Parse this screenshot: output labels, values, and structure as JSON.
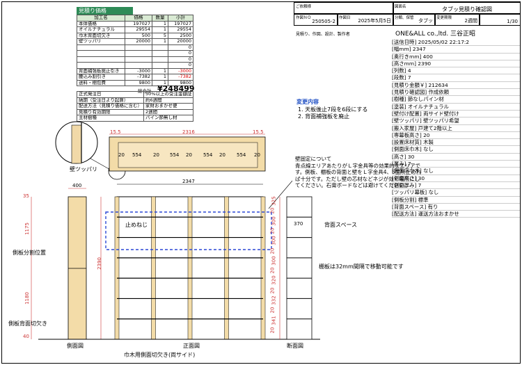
{
  "estimate": {
    "title": "見積り価格",
    "headers": [
      "加工名",
      "価格",
      "数量",
      "小計"
    ],
    "rows": [
      [
        "本体価格",
        "197027",
        "1",
        "197027"
      ],
      [
        "オイルナチュラル",
        "29554",
        "1",
        "29554"
      ],
      [
        "巾木背面切欠き",
        "500",
        "5",
        "2500"
      ],
      [
        "壁ツッパリ",
        "20000",
        "1",
        "20000"
      ],
      [
        "",
        "",
        "",
        "0"
      ],
      [
        "",
        "",
        "",
        "0"
      ],
      [
        "",
        "",
        "",
        "0"
      ],
      [
        "",
        "",
        "",
        "0"
      ],
      [
        "背面補強板廃止引き",
        "-3000",
        "1",
        "-3000"
      ],
      [
        "腰込み割引き",
        "-7382",
        "1",
        "-7382"
      ],
      [
        "送料・梱包費",
        "9800",
        "1",
        "9800"
      ]
    ],
    "total_label": "総合計",
    "total_value": "¥248499",
    "terms": [
      [
        "正式発注日",
        "50%以上の受注金額証"
      ],
      [
        "納期（受注日より起算）",
        "約6週間"
      ],
      [
        "配送方法（見積り価格に含む）",
        "家財おまかせ便"
      ],
      [
        "見積り有効期限",
        "2週間"
      ],
      [
        "主材樹種",
        "パイン節無し材"
      ]
    ]
  },
  "title_block": {
    "approve_label": "ご依頼様",
    "drawing_name_label": "図面名",
    "drawing_name": "タブッ見積り確認図",
    "drawing_no_label": "作図ＮＯ",
    "drawing_no": "250505-2",
    "date_label": "作図日",
    "date": "2025年5月5日",
    "category_label": "分類、保管",
    "category": "タブッ",
    "period_label": "変更期限",
    "period": "2週間",
    "page": "1/30",
    "maker_label": "見積り、作図、設計、製作者",
    "maker": "ONE&ALL co.,ltd. 三谷正昭"
  },
  "specs": [
    "[送信日時] 2025/05/02 22:17:2",
    "[幅mm] 2347",
    "[奥行きmm] 400",
    "[高さmm] 2390",
    "[列数] 4",
    "[段数] 7",
    "[見積り金額￥] 212634",
    "[見積り確認図] 作成依頼",
    "[樹種] 節なしパイン材",
    "[塗装] オイルナチュラル",
    "[壁付け配置] 両サイド壁付け",
    "[壁ツッパリ] 壁ツッパリ希望",
    "[搬入家屋] 戸建て2階以上",
    "[専幕板高さ] 20",
    "[設置床材質] 木製",
    "[側面床巾木] なし",
    "[高さ] 30",
    "[厚み] 7",
    "[側面床巾木] なし",
    "[側面高さ] 30",
    "[側面厚み] 7",
    "[ツッパリ幕板] なし",
    "[側板分割] 標準",
    "[背面スペース] 有り",
    "[配送方法] 運送方法おまかせ"
  ],
  "changes": {
    "title": "変更内容",
    "items": [
      "1. 天板後止7段を6段にする",
      "2. 背面補強板を廃止"
    ]
  },
  "wall_note": "壁固定について\n青点線エリアあたりがＬ字金具等の効果的なエリアです。側板、棚板の背面と壁をＬ字金具4、5箇所止めれば十分です。ただし壁の芯材などネジが効く場所にしてください。石膏ボードなどは避けてください。",
  "labels": {
    "wall_brace": "壁ツッパリ",
    "side_split": "側板分割位置",
    "side_notch": "側板背面切欠き",
    "side_view": "側面図",
    "front_view": "正面図",
    "section_view": "断面図",
    "baseboard_notch": "巾木用側面切欠き(両サイド)",
    "back_space": "背面スペース",
    "shelf_note": "棚板は32mm間隔で移動可能です",
    "stop_screw": "止めねじ"
  },
  "dims": {
    "top_width": "2316",
    "top_left": "15.5",
    "top_right": "15.5",
    "top_cells": [
      "20",
      "554",
      "20",
      "554",
      "20",
      "554",
      "20",
      "554",
      "20"
    ],
    "front_width": "2347",
    "side_width": "400",
    "left_heights": [
      "35",
      "1175",
      "1180",
      "40"
    ],
    "total_height": "2390",
    "right_heights": [
      "325",
      "20",
      "300",
      "20",
      "300",
      "20",
      "300",
      "20",
      "320",
      "20",
      "332",
      "20",
      "341",
      "20"
    ],
    "section_width": "370"
  }
}
